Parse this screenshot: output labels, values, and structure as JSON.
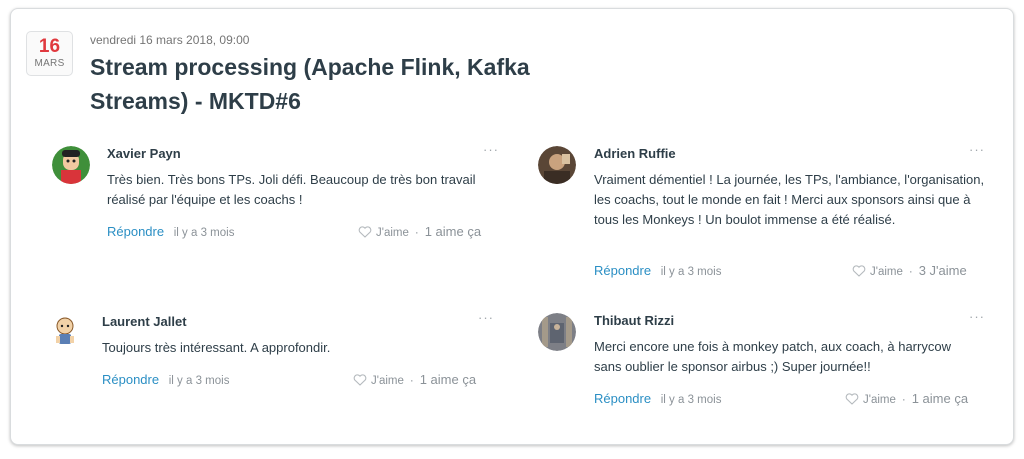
{
  "event": {
    "day": "16",
    "month": "MARS",
    "datetime": "vendredi 16 mars 2018, 09:00",
    "title": "Stream processing (Apache Flink, Kafka Streams) - MKTD#6"
  },
  "comments": [
    {
      "author": "Xavier Payn",
      "text": "Très bien. Très bons TPs. Joli défi. Beaucoup de très bon travail réalisé par l'équipe et les coachs !",
      "reply_label": "Répondre",
      "time": "il y a 3 mois",
      "like_label": "J'aime",
      "like_count": "1 aime ça",
      "more": "···"
    },
    {
      "author": "Adrien Ruffie",
      "text": "Vraiment démentiel ! La journée, les TPs, l'ambiance, l'organisation, les coachs, tout le monde en fait ! Merci aux sponsors ainsi que à tous les Monkeys ! Un boulot immense a été réalisé.",
      "reply_label": "Répondre",
      "time": "il y a 3 mois",
      "like_label": "J'aime",
      "like_count": "3 J'aime",
      "more": "···"
    },
    {
      "author": "Laurent Jallet",
      "text": "Toujours très intéressant. A approfondir.",
      "reply_label": "Répondre",
      "time": "il y a 3 mois",
      "like_label": "J'aime",
      "like_count": "1 aime ça",
      "more": "···"
    },
    {
      "author": "Thibaut Rizzi",
      "text": "Merci encore une fois à monkey patch, aux coach, à harrycow sans oublier le sponsor airbus ;) Super journée!!",
      "reply_label": "Répondre",
      "time": "il y a 3 mois",
      "like_label": "J'aime",
      "like_count": "1 aime ça",
      "more": "···"
    }
  ],
  "colors": {
    "accent_date": "#e0393e",
    "link": "#2b8fc4",
    "text": "#2e3e48",
    "muted": "#8b9298"
  }
}
